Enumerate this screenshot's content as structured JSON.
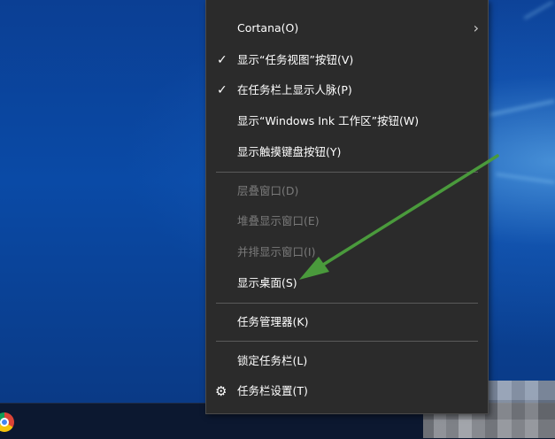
{
  "menu": {
    "cortana": "Cortana(O)",
    "show_task_view": "显示“任务视图”按钮(V)",
    "show_people": "在任务栏上显示人脉(P)",
    "show_ink": "显示“Windows Ink 工作区”按钮(W)",
    "show_touch_keyboard": "显示触摸键盘按钮(Y)",
    "cascade": "层叠窗口(D)",
    "stack": "堆叠显示窗口(E)",
    "side_by_side": "并排显示窗口(I)",
    "show_desktop": "显示桌面(S)",
    "task_manager": "任务管理器(K)",
    "lock_taskbar": "锁定任务栏(L)",
    "taskbar_settings": "任务栏设置(T)"
  },
  "icons": {
    "check": "check-icon",
    "chevron": "chevron-right-icon",
    "gear": "gear-icon"
  },
  "colors": {
    "menu_bg": "#2b2b2b",
    "text": "#ffffff",
    "disabled_text": "#7a7a7a",
    "arrow": "#4a9a3c"
  }
}
